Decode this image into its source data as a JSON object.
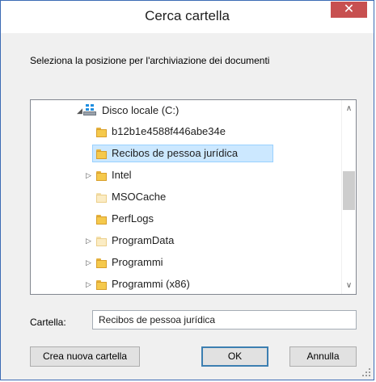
{
  "window": {
    "title": "Cerca cartella",
    "close_glyph": "✕"
  },
  "instruction": "Seleziona la posizione per l'archiviazione dei documenti",
  "tree": {
    "root": {
      "label": "Disco locale (C:)",
      "icon": "drive-icon",
      "expanded": true
    },
    "items": [
      {
        "label": "b12b1e4588f446abe34e",
        "has_children": false,
        "icon": "folder-icon"
      },
      {
        "label": "Recibos de pessoa jurídica",
        "has_children": false,
        "icon": "folder-icon",
        "selected": true
      },
      {
        "label": "Intel",
        "has_children": true,
        "icon": "folder-icon"
      },
      {
        "label": "MSOCache",
        "has_children": false,
        "icon": "folder-icon",
        "hidden": true
      },
      {
        "label": "PerfLogs",
        "has_children": false,
        "icon": "folder-icon"
      },
      {
        "label": "ProgramData",
        "has_children": true,
        "icon": "folder-icon",
        "hidden": true
      },
      {
        "label": "Programmi",
        "has_children": true,
        "icon": "folder-icon"
      },
      {
        "label": "Programmi (x86)",
        "has_children": true,
        "icon": "folder-icon"
      }
    ],
    "glyphs": {
      "expanded": "◢",
      "collapsed": "▷",
      "scroll_up": "∧",
      "scroll_down": "∨"
    }
  },
  "folder_field": {
    "label": "Cartella:",
    "value": "Recibos de pessoa jurídica"
  },
  "buttons": {
    "new_folder": "Crea nuova cartella",
    "ok": "OK",
    "cancel": "Annulla"
  },
  "colors": {
    "accent": "#3c6bb4",
    "close": "#c75050",
    "selection": "#cce8ff",
    "folder": "#f5c94c"
  }
}
